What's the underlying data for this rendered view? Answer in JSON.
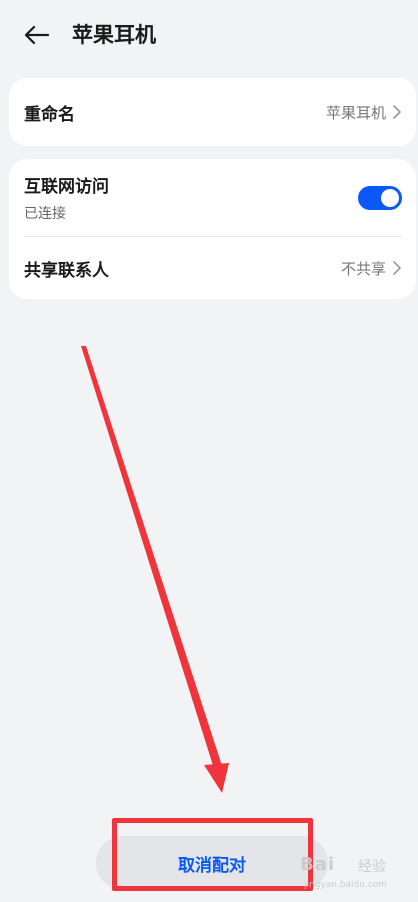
{
  "header": {
    "title": "苹果耳机",
    "back_icon": "arrow-left-icon"
  },
  "rename": {
    "label": "重命名",
    "value": "苹果耳机"
  },
  "internet": {
    "label": "互联网访问",
    "status": "已连接",
    "toggle_on": true
  },
  "contacts": {
    "label": "共享联系人",
    "value": "不共享"
  },
  "unpair": {
    "label": "取消配对"
  },
  "watermark": {
    "brand": "Bai",
    "text": "经验",
    "url": "jingyan.baidu.com"
  },
  "colors": {
    "accent": "#0a59f7",
    "annotation": "#f0343c",
    "background": "#f1f3f5"
  }
}
